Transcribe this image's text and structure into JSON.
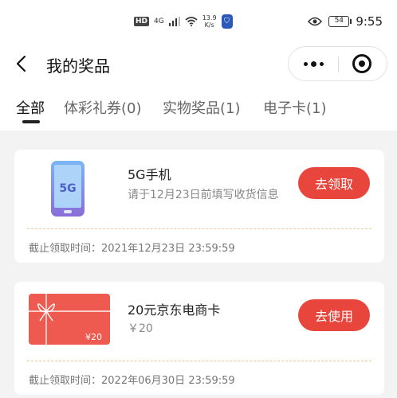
{
  "status_bar": {
    "hd": "HD",
    "network": "4G",
    "speed_value": "13.9",
    "speed_unit": "K/s",
    "battery": "54",
    "time": "9:55"
  },
  "header": {
    "title": "我的奖品"
  },
  "tabs": [
    {
      "label": "全部",
      "active": true
    },
    {
      "label": "体彩礼券(0)"
    },
    {
      "label": "实物奖品(1)"
    },
    {
      "label": "电子卡(1)"
    }
  ],
  "prizes": [
    {
      "icon_text": "5G",
      "name": "5G手机",
      "sub": "请于12月23日前填写收货信息",
      "button": "去领取",
      "deadline_label": "截止领取时间：",
      "deadline": "2021年12月23日 23:59:59"
    },
    {
      "icon_text": "¥20",
      "name": "20元京东电商卡",
      "sub": "￥20",
      "button": "去使用",
      "deadline_label": "截止领取时间：",
      "deadline": "2022年06月30日 23:59:59"
    }
  ],
  "colors": {
    "accent": "#e8453c",
    "dash": "#e6c89b",
    "background": "#f3f3f3"
  }
}
